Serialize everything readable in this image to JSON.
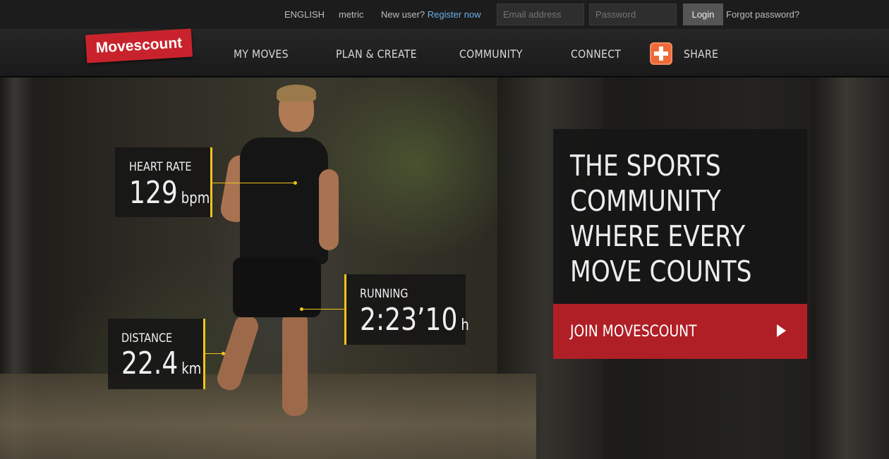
{
  "topbar": {
    "language": "ENGLISH",
    "units": "metric",
    "new_user_text": "New user?",
    "register_link": "Register now",
    "email_placeholder": "Email address",
    "password_placeholder": "Password",
    "login_label": "Login",
    "forgot_password": "Forgot password?"
  },
  "nav": {
    "logo_text": "Movescount",
    "items": [
      "MY MOVES",
      "PLAN & CREATE",
      "COMMUNITY",
      "CONNECT",
      "SHARE"
    ],
    "share_icon": "plus-icon"
  },
  "stats": {
    "heart_rate": {
      "label": "HEART RATE",
      "value": "129",
      "unit": "bpm"
    },
    "running": {
      "label": "RUNNING",
      "value": "2:23’10",
      "unit": "h"
    },
    "distance": {
      "label": "DISTANCE",
      "value": "22.4",
      "unit": "km"
    }
  },
  "tagline": {
    "lines": [
      "THE SPORTS",
      "COMMUNITY",
      "WHERE EVERY",
      "MOVE COUNTS"
    ]
  },
  "cta": {
    "label": "JOIN MOVESCOUNT",
    "icon": "play-arrow-icon"
  },
  "colors": {
    "brand_red": "#c8232c",
    "cta_red": "#b01f26",
    "accent_yellow": "#f2c418",
    "link_blue": "#6ab0e8",
    "share_orange": "#ef6a3a"
  }
}
